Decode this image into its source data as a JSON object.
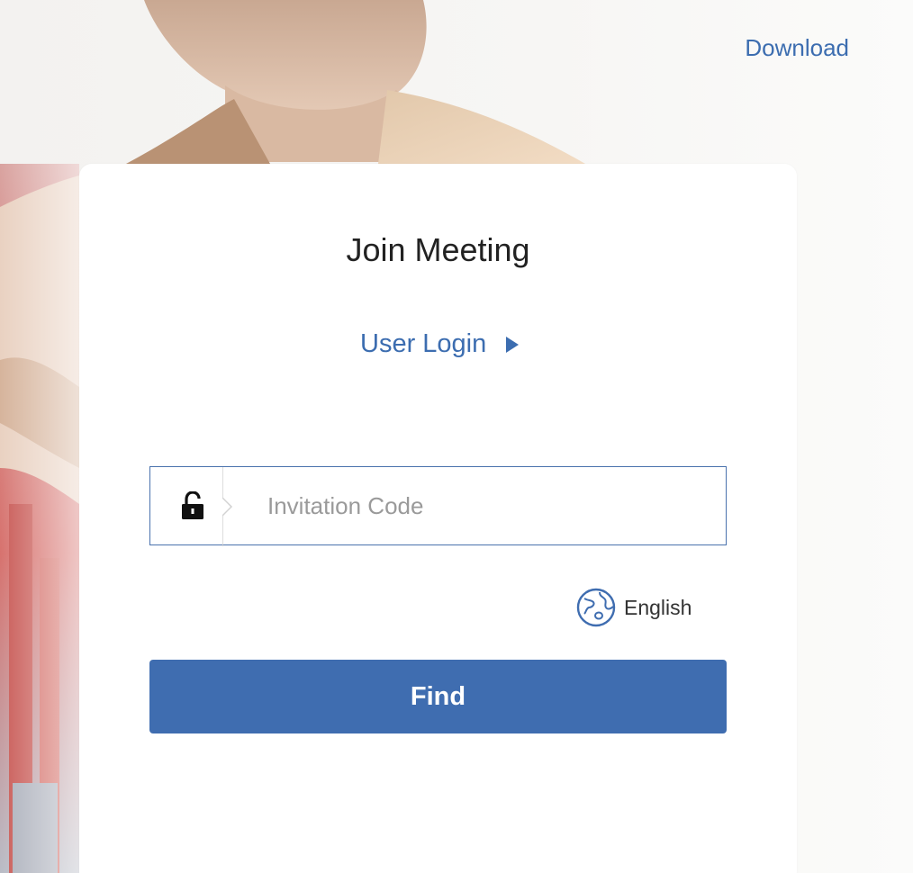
{
  "header": {
    "download_label": "Download"
  },
  "card": {
    "title": "Join Meeting",
    "user_login_label": "User Login",
    "invitation_code": {
      "placeholder": "Invitation Code",
      "value": ""
    },
    "language_label": "English",
    "find_label": "Find"
  },
  "colors": {
    "accent": "#3f6db0",
    "link": "#3c6db0",
    "field_border": "#4a72ad"
  },
  "icons": {
    "lock": "unlocked-padlock-icon",
    "language": "globe-icon",
    "user_login_arrow": "play-triangle-icon"
  }
}
